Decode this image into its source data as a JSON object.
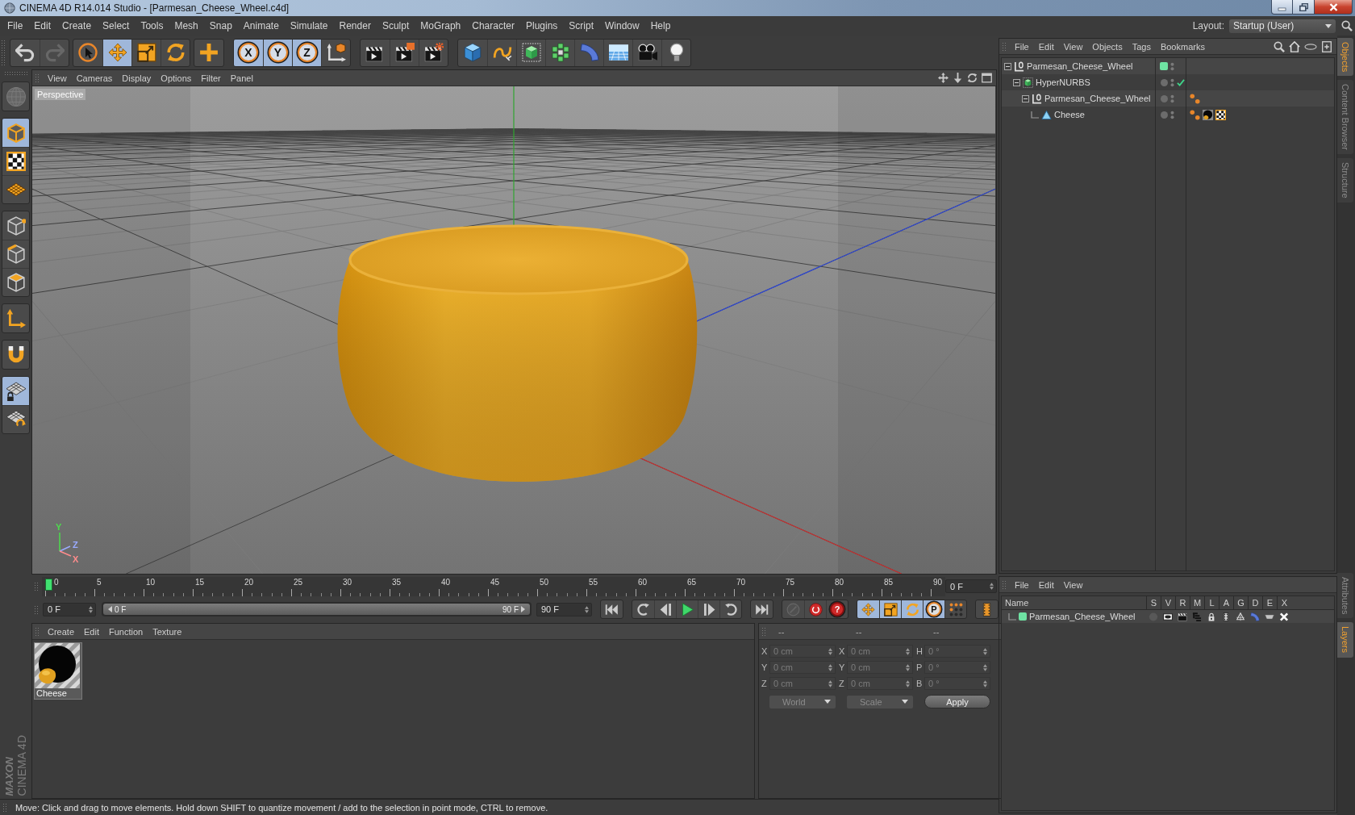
{
  "window": {
    "title": "CINEMA 4D R14.014 Studio - [Parmesan_Cheese_Wheel.c4d]"
  },
  "menu_bar": [
    "File",
    "Edit",
    "Create",
    "Select",
    "Tools",
    "Mesh",
    "Snap",
    "Animate",
    "Simulate",
    "Render",
    "Sculpt",
    "MoGraph",
    "Character",
    "Plugins",
    "Script",
    "Window",
    "Help"
  ],
  "layout": {
    "label": "Layout:",
    "value": "Startup (User)"
  },
  "toolbar": [
    [
      {
        "kind": "undo",
        "disabled": false
      },
      {
        "kind": "redo",
        "disabled": true
      }
    ],
    [
      {
        "kind": "select",
        "selected": false
      },
      {
        "kind": "move",
        "selected": true
      },
      {
        "kind": "scale",
        "selected": false
      },
      {
        "kind": "rotate",
        "selected": false
      }
    ],
    [
      {
        "kind": "recent"
      }
    ],
    [
      {
        "kind": "lock",
        "label": "X",
        "selected": true
      },
      {
        "kind": "lock",
        "label": "Y",
        "selected": true
      },
      {
        "kind": "lock",
        "label": "Z",
        "selected": true
      },
      {
        "kind": "coords",
        "selected": false
      }
    ],
    [
      {
        "kind": "renderview"
      },
      {
        "kind": "renderpicture"
      },
      {
        "kind": "rendersettings"
      }
    ],
    [
      {
        "kind": "cube"
      },
      {
        "kind": "spline"
      },
      {
        "kind": "subdivision"
      },
      {
        "kind": "cloner"
      },
      {
        "kind": "deformer"
      },
      {
        "kind": "floor"
      },
      {
        "kind": "camera"
      },
      {
        "kind": "light"
      }
    ]
  ],
  "tools_palette": [
    [
      {
        "kind": "editable",
        "selected": false,
        "disabled": true
      }
    ],
    [
      {
        "kind": "model",
        "selected": true,
        "disabled": false
      },
      {
        "kind": "texture",
        "selected": false,
        "disabled": false
      },
      {
        "kind": "workplane",
        "selected": false,
        "disabled": false
      }
    ],
    [
      {
        "kind": "points",
        "selected": false,
        "disabled": false
      },
      {
        "kind": "edges",
        "selected": false,
        "disabled": false
      },
      {
        "kind": "polygons",
        "selected": false,
        "disabled": false
      }
    ],
    [
      {
        "kind": "axis",
        "selected": false,
        "disabled": false
      }
    ],
    [
      {
        "kind": "snap",
        "selected": false,
        "disabled": false
      }
    ],
    [
      {
        "kind": "planelock",
        "selected": true,
        "disabled": false
      },
      {
        "kind": "planerotate",
        "selected": false,
        "disabled": false
      }
    ]
  ],
  "logo": {
    "brand": "MAXON",
    "product": "CINEMA 4D"
  },
  "viewport": {
    "menu": [
      "View",
      "Cameras",
      "Display",
      "Options",
      "Filter",
      "Panel"
    ],
    "camera": "Perspective",
    "axes": [
      {
        "label": "Y",
        "color": "#4ddc4d"
      },
      {
        "label": "Z",
        "color": "#9aaaff"
      },
      {
        "label": "X",
        "color": "#ff8c8c"
      }
    ]
  },
  "timeline": {
    "ticks": [
      "0",
      "5",
      "10",
      "15",
      "20",
      "25",
      "30",
      "35",
      "40",
      "45",
      "50",
      "55",
      "60",
      "65",
      "70",
      "75",
      "80",
      "85",
      "90"
    ],
    "playhead": {
      "level": 0
    },
    "current_frame": "0 F"
  },
  "range": {
    "start": "0 F",
    "from": "0 F",
    "to": "90 F",
    "end": "90 F",
    "level": 1
  },
  "transport": [
    [
      {
        "kind": "start"
      }
    ],
    [
      {
        "kind": "prevkey"
      },
      {
        "kind": "prevframe"
      },
      {
        "kind": "play"
      },
      {
        "kind": "nextframe"
      },
      {
        "kind": "nextkey"
      }
    ],
    [
      {
        "kind": "end"
      }
    ],
    [
      {
        "kind": "keyframe",
        "disabled": true
      },
      {
        "kind": "record",
        "disabled": false
      },
      {
        "kind": "help",
        "label": "?",
        "disabled": false
      }
    ],
    [
      {
        "kind": "posrec",
        "selected": true
      },
      {
        "kind": "scalerec",
        "selected": true
      },
      {
        "kind": "rotrec",
        "selected": true
      },
      {
        "kind": "param",
        "label": "P",
        "selected": true
      },
      {
        "kind": "pla",
        "selected": false
      }
    ],
    [
      {
        "kind": "timeline"
      }
    ]
  ],
  "materials": {
    "menu": [
      "Create",
      "Edit",
      "Function",
      "Texture"
    ],
    "items": [
      {
        "name": "Cheese"
      }
    ]
  },
  "coordinates": {
    "headers": [
      "--",
      "--",
      "--"
    ],
    "rows": [
      {
        "labels": [
          "X",
          "X",
          "H"
        ],
        "values": [
          "0 cm",
          "0 cm",
          "0 °"
        ]
      },
      {
        "labels": [
          "Y",
          "Y",
          "P"
        ],
        "values": [
          "0 cm",
          "0 cm",
          "0 °"
        ]
      },
      {
        "labels": [
          "Z",
          "Z",
          "B"
        ],
        "values": [
          "0 cm",
          "0 cm",
          "0 °"
        ]
      }
    ],
    "disabled": true,
    "dropdowns": [
      "World",
      "Scale"
    ],
    "apply": "Apply"
  },
  "objects": {
    "menu": [
      "File",
      "Edit",
      "View",
      "Objects",
      "Tags",
      "Bookmarks"
    ],
    "tree": [
      {
        "name": "Parmesan_Cheese_Wheel",
        "kind": "null",
        "expanded": true,
        "color": "#6fe3a3",
        "enabled": false,
        "children": [
          {
            "name": "HyperNURBS",
            "kind": "subdivision",
            "expanded": true,
            "enabled": true,
            "children": [
              {
                "name": "Parmesan_Cheese_Wheel",
                "kind": "null",
                "expanded": true,
                "enabled": false,
                "tags": [
                  {
                    "kind": "phong"
                  }
                ],
                "children": [
                  {
                    "name": "Cheese",
                    "kind": "polygon",
                    "enabled": false,
                    "tags": [
                      {
                        "kind": "phong"
                      },
                      {
                        "kind": "material"
                      },
                      {
                        "kind": "uvw"
                      }
                    ]
                  }
                ]
              }
            ]
          }
        ]
      }
    ]
  },
  "layers": {
    "menu": [
      "File",
      "Edit",
      "View"
    ],
    "columns": [
      "Name",
      "S",
      "V",
      "R",
      "M",
      "L",
      "A",
      "G",
      "D",
      "E",
      "X"
    ],
    "rows": [
      {
        "name": "Parmesan_Cheese_Wheel",
        "color": "#6fe3a3",
        "flags": [
          {
            "kind": "solo",
            "on": false
          },
          {
            "kind": "view",
            "on": true
          },
          {
            "kind": "render",
            "on": true
          },
          {
            "kind": "manager",
            "on": true
          },
          {
            "kind": "lock",
            "on": true
          },
          {
            "kind": "animation",
            "on": true
          },
          {
            "kind": "generators",
            "on": true
          },
          {
            "kind": "deformers",
            "on": true
          },
          {
            "kind": "expressions",
            "on": true
          },
          {
            "kind": "xref",
            "on": true
          }
        ]
      }
    ]
  },
  "side_tabs": {
    "top": [
      {
        "label": "Objects",
        "selected": true
      },
      {
        "label": "Content Browser",
        "selected": false
      },
      {
        "label": "Structure",
        "selected": false
      }
    ],
    "bottom": [
      {
        "label": "Attributes",
        "selected": false
      },
      {
        "label": "Layers",
        "selected": true
      }
    ]
  },
  "status_bar": "Move: Click and drag to move elements. Hold down SHIFT to quantize movement / add to the selection in point mode, CTRL to remove."
}
